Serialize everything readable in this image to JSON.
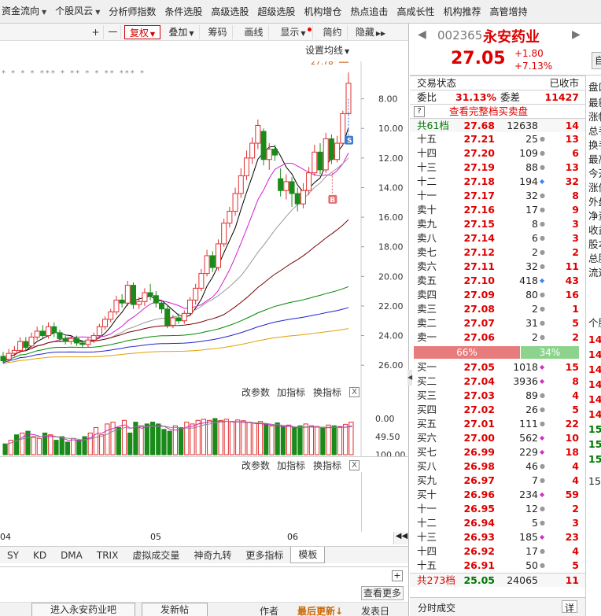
{
  "top_nav": [
    {
      "label": "资金流向",
      "dd": true
    },
    {
      "label": "个股风云",
      "dd": true
    },
    {
      "label": "分析师指数",
      "dd": false
    },
    {
      "label": "条件选股",
      "dd": false
    },
    {
      "label": "高级选股",
      "dd": false
    },
    {
      "label": "超级选股",
      "dd": false
    },
    {
      "label": "机构增仓",
      "dd": false
    },
    {
      "label": "热点追击",
      "dd": false
    },
    {
      "label": "高成长性",
      "dd": false
    },
    {
      "label": "机构推荐",
      "dd": false
    },
    {
      "label": "高管增持",
      "dd": false
    }
  ],
  "toolbar": {
    "plus": "+",
    "minus": "一",
    "fuquan": "复权",
    "overlay": "叠加",
    "chips": "筹码",
    "draw": "画线",
    "display": "显示",
    "simple": "简约",
    "hide": "隐藏"
  },
  "main_chart": {
    "set_ma": "设置均线",
    "high_label": "27.78",
    "y_ticks": [
      "26.00",
      "24.00",
      "22.00",
      "20.00",
      "18.00",
      "16.00",
      "14.00",
      "12.00",
      "10.00",
      "8.00"
    ],
    "marker_s": "S",
    "marker_b": "B",
    "stars": "* * * * *** * ** * * ** *** *"
  },
  "indicator_panel": {
    "change_params": "改参数",
    "add_indicator": "加指标",
    "swap_indicator": "换指标",
    "close": "X",
    "y_ticks": [
      "100.00",
      "49.50",
      "0.00"
    ]
  },
  "empty_panel": {
    "change_params": "改参数",
    "add_indicator": "加指标",
    "swap_indicator": "换指标",
    "close": "X"
  },
  "x_axis": [
    "04",
    "05",
    "06"
  ],
  "tabs": [
    "SY",
    "KD",
    "DMA",
    "TRIX",
    "虚拟成交量",
    "神奇九转",
    "更多指标",
    "模板"
  ],
  "lower": {
    "view_more": "查看更多",
    "enter_bar": "进入永安药业吧",
    "post": "发新帖",
    "author": "作者",
    "last_update": "最后更新",
    "post_date": "发表日"
  },
  "quote": {
    "code": "002365",
    "name": "永安药业",
    "price": "27.05",
    "change": "+1.80",
    "change_pct": "+7.13%",
    "side_btn": "自",
    "status_label": "交易状态",
    "status_value": "已收市",
    "weibi_label": "委比",
    "weibi_value": "31.13%",
    "weicha_label": "委差",
    "weicha_value": "11427",
    "full_book": "查看完整档买卖盘",
    "help": "?",
    "sell_total": {
      "label": "共61档",
      "price": "27.68",
      "vol": "12638",
      "cnt": "14"
    },
    "sells": [
      {
        "label": "十五",
        "price": "27.21",
        "vol": "25",
        "mark": "dot",
        "cnt": "13"
      },
      {
        "label": "十四",
        "price": "27.20",
        "vol": "109",
        "mark": "dot",
        "cnt": "6"
      },
      {
        "label": "十三",
        "price": "27.19",
        "vol": "88",
        "mark": "dot",
        "cnt": "13"
      },
      {
        "label": "十二",
        "price": "27.18",
        "vol": "194",
        "mark": "blue",
        "cnt": "32"
      },
      {
        "label": "十一",
        "price": "27.17",
        "vol": "32",
        "mark": "dot",
        "cnt": "8"
      },
      {
        "label": "卖十",
        "price": "27.16",
        "vol": "17",
        "mark": "dot",
        "cnt": "9"
      },
      {
        "label": "卖九",
        "price": "27.15",
        "vol": "8",
        "mark": "dot",
        "cnt": "3"
      },
      {
        "label": "卖八",
        "price": "27.14",
        "vol": "6",
        "mark": "dot",
        "cnt": "3"
      },
      {
        "label": "卖七",
        "price": "27.12",
        "vol": "2",
        "mark": "dot",
        "cnt": "2"
      },
      {
        "label": "卖六",
        "price": "27.11",
        "vol": "32",
        "mark": "dot",
        "cnt": "11"
      },
      {
        "label": "卖五",
        "price": "27.10",
        "vol": "418",
        "mark": "blue",
        "cnt": "43"
      },
      {
        "label": "卖四",
        "price": "27.09",
        "vol": "80",
        "mark": "dot",
        "cnt": "16"
      },
      {
        "label": "卖三",
        "price": "27.08",
        "vol": "2",
        "mark": "dot",
        "cnt": "1"
      },
      {
        "label": "卖二",
        "price": "27.07",
        "vol": "31",
        "mark": "dot",
        "cnt": "5"
      },
      {
        "label": "卖一",
        "price": "27.06",
        "vol": "2",
        "mark": "dot",
        "cnt": "2"
      }
    ],
    "ratio_buy": "66%",
    "ratio_sell": "34%",
    "buys": [
      {
        "label": "买一",
        "price": "27.05",
        "vol": "1018",
        "mark": "mag",
        "cnt": "15"
      },
      {
        "label": "买二",
        "price": "27.04",
        "vol": "3936",
        "mark": "mag",
        "cnt": "8"
      },
      {
        "label": "买三",
        "price": "27.03",
        "vol": "89",
        "mark": "dot",
        "cnt": "4"
      },
      {
        "label": "买四",
        "price": "27.02",
        "vol": "26",
        "mark": "dot",
        "cnt": "5"
      },
      {
        "label": "买五",
        "price": "27.01",
        "vol": "111",
        "mark": "dot",
        "cnt": "22"
      },
      {
        "label": "买六",
        "price": "27.00",
        "vol": "562",
        "mark": "mag",
        "cnt": "10"
      },
      {
        "label": "买七",
        "price": "26.99",
        "vol": "229",
        "mark": "mag",
        "cnt": "18"
      },
      {
        "label": "买八",
        "price": "26.98",
        "vol": "46",
        "mark": "dot",
        "cnt": "4"
      },
      {
        "label": "买九",
        "price": "26.97",
        "vol": "7",
        "mark": "dot",
        "cnt": "4"
      },
      {
        "label": "买十",
        "price": "26.96",
        "vol": "234",
        "mark": "mag",
        "cnt": "59"
      },
      {
        "label": "十一",
        "price": "26.95",
        "vol": "12",
        "mark": "dot",
        "cnt": "2"
      },
      {
        "label": "十二",
        "price": "26.94",
        "vol": "5",
        "mark": "dot",
        "cnt": "3"
      },
      {
        "label": "十三",
        "price": "26.93",
        "vol": "185",
        "mark": "mag",
        "cnt": "23"
      },
      {
        "label": "十四",
        "price": "26.92",
        "vol": "17",
        "mark": "dot",
        "cnt": "4"
      },
      {
        "label": "十五",
        "price": "26.91",
        "vol": "50",
        "mark": "dot",
        "cnt": "5"
      }
    ],
    "buy_total": {
      "label": "共273档",
      "price": "25.05",
      "vol": "24065",
      "cnt": "11"
    },
    "time_trade": "分时成交",
    "detail": "详"
  },
  "side_panel": {
    "head": "盘口",
    "labels": [
      "最新",
      "涨幅",
      "总手",
      "换手",
      "最高",
      "今开",
      "涨停",
      "外盘",
      "净资",
      "收益",
      "股本",
      "总股",
      "流通"
    ],
    "mid_head": "个股",
    "values": [
      "14",
      "14",
      "14",
      "14",
      "14",
      "14",
      "15",
      "15",
      "15"
    ],
    "last": "15"
  },
  "chart_data": [
    {
      "type": "candlestick",
      "x": [
        "04",
        "05",
        "06"
      ],
      "ylim": [
        7,
        28
      ],
      "y_ticks": [
        8,
        10,
        12,
        14,
        16,
        18,
        20,
        22,
        24,
        26
      ],
      "candles": [
        {
          "o": 8.6,
          "c": 8.3,
          "h": 8.9,
          "l": 8.1
        },
        {
          "o": 8.4,
          "c": 8.8,
          "h": 9.1,
          "l": 8.2
        },
        {
          "o": 8.8,
          "c": 9.0,
          "h": 9.3,
          "l": 8.6
        },
        {
          "o": 9.0,
          "c": 9.6,
          "h": 9.9,
          "l": 8.8
        },
        {
          "o": 9.6,
          "c": 9.2,
          "h": 9.9,
          "l": 9.0
        },
        {
          "o": 9.3,
          "c": 9.9,
          "h": 10.2,
          "l": 9.1
        },
        {
          "o": 9.9,
          "c": 10.3,
          "h": 10.6,
          "l": 9.7
        },
        {
          "o": 10.3,
          "c": 10.0,
          "h": 10.7,
          "l": 9.8
        },
        {
          "o": 10.0,
          "c": 10.6,
          "h": 10.9,
          "l": 9.8
        },
        {
          "o": 10.6,
          "c": 10.2,
          "h": 10.9,
          "l": 9.9
        },
        {
          "o": 10.2,
          "c": 9.8,
          "h": 10.4,
          "l": 9.6
        },
        {
          "o": 9.8,
          "c": 9.6,
          "h": 10.0,
          "l": 9.4
        },
        {
          "o": 9.6,
          "c": 9.8,
          "h": 10.0,
          "l": 9.4
        },
        {
          "o": 9.8,
          "c": 9.5,
          "h": 10.0,
          "l": 9.3
        },
        {
          "o": 9.5,
          "c": 9.4,
          "h": 9.7,
          "l": 9.2
        },
        {
          "o": 9.4,
          "c": 9.7,
          "h": 9.9,
          "l": 9.2
        },
        {
          "o": 9.7,
          "c": 10.0,
          "h": 10.2,
          "l": 9.5
        },
        {
          "o": 10.0,
          "c": 10.6,
          "h": 10.8,
          "l": 9.8
        },
        {
          "o": 10.6,
          "c": 11.1,
          "h": 11.3,
          "l": 10.4
        },
        {
          "o": 11.1,
          "c": 11.6,
          "h": 11.8,
          "l": 10.9
        },
        {
          "o": 11.6,
          "c": 12.4,
          "h": 12.7,
          "l": 11.4
        },
        {
          "o": 12.4,
          "c": 12.2,
          "h": 12.8,
          "l": 11.9
        },
        {
          "o": 12.2,
          "c": 13.4,
          "h": 13.7,
          "l": 12.0
        },
        {
          "o": 13.4,
          "c": 12.1,
          "h": 13.6,
          "l": 11.8
        },
        {
          "o": 12.1,
          "c": 12.3,
          "h": 12.6,
          "l": 11.8
        },
        {
          "o": 12.3,
          "c": 12.9,
          "h": 13.2,
          "l": 12.0
        },
        {
          "o": 12.9,
          "c": 12.7,
          "h": 13.5,
          "l": 12.4
        },
        {
          "o": 12.7,
          "c": 12.2,
          "h": 13.0,
          "l": 11.9
        },
        {
          "o": 12.2,
          "c": 11.8,
          "h": 12.4,
          "l": 11.5
        },
        {
          "o": 11.8,
          "c": 10.7,
          "h": 12.0,
          "l": 10.5
        },
        {
          "o": 10.7,
          "c": 11.2,
          "h": 11.4,
          "l": 10.5
        },
        {
          "o": 11.2,
          "c": 11.0,
          "h": 11.5,
          "l": 10.8
        },
        {
          "o": 11.0,
          "c": 11.5,
          "h": 11.7,
          "l": 10.8
        },
        {
          "o": 11.5,
          "c": 12.4,
          "h": 12.6,
          "l": 11.3
        },
        {
          "o": 12.4,
          "c": 13.2,
          "h": 13.5,
          "l": 12.1
        },
        {
          "o": 13.2,
          "c": 14.2,
          "h": 14.5,
          "l": 13.0
        },
        {
          "o": 14.2,
          "c": 15.4,
          "h": 15.8,
          "l": 14.0
        },
        {
          "o": 15.4,
          "c": 14.6,
          "h": 15.7,
          "l": 14.3
        },
        {
          "o": 14.6,
          "c": 16.2,
          "h": 16.5,
          "l": 14.4
        },
        {
          "o": 16.2,
          "c": 17.6,
          "h": 17.9,
          "l": 16.0
        },
        {
          "o": 17.6,
          "c": 18.4,
          "h": 18.7,
          "l": 17.3
        },
        {
          "o": 18.4,
          "c": 19.6,
          "h": 20.0,
          "l": 18.1
        },
        {
          "o": 19.6,
          "c": 20.8,
          "h": 21.3,
          "l": 19.3
        },
        {
          "o": 20.8,
          "c": 22.0,
          "h": 22.5,
          "l": 20.5
        },
        {
          "o": 22.0,
          "c": 23.0,
          "h": 23.4,
          "l": 21.6
        },
        {
          "o": 23.0,
          "c": 24.2,
          "h": 24.6,
          "l": 22.6
        },
        {
          "o": 23.8,
          "c": 21.9,
          "h": 24.0,
          "l": 21.5
        },
        {
          "o": 21.9,
          "c": 22.6,
          "h": 23.0,
          "l": 21.2
        },
        {
          "o": 22.6,
          "c": 22.2,
          "h": 22.9,
          "l": 21.8
        },
        {
          "o": 20.6,
          "c": 19.8,
          "h": 21.3,
          "l": 19.4
        },
        {
          "o": 19.8,
          "c": 20.4,
          "h": 20.9,
          "l": 19.2
        },
        {
          "o": 20.4,
          "c": 19.6,
          "h": 20.7,
          "l": 18.7
        },
        {
          "o": 19.6,
          "c": 18.9,
          "h": 20.0,
          "l": 18.4
        },
        {
          "o": 18.9,
          "c": 19.8,
          "h": 20.3,
          "l": 18.6
        },
        {
          "o": 19.8,
          "c": 21.0,
          "h": 21.4,
          "l": 19.5
        },
        {
          "o": 21.0,
          "c": 22.4,
          "h": 22.9,
          "l": 20.8
        },
        {
          "o": 22.4,
          "c": 21.2,
          "h": 23.0,
          "l": 20.9
        },
        {
          "o": 21.2,
          "c": 23.3,
          "h": 23.7,
          "l": 21.0
        },
        {
          "o": 23.3,
          "c": 21.9,
          "h": 23.6,
          "l": 21.6
        },
        {
          "o": 21.9,
          "c": 23.0,
          "h": 23.5,
          "l": 21.7
        },
        {
          "o": 23.0,
          "c": 25.0,
          "h": 25.2,
          "l": 22.9
        },
        {
          "o": 25.0,
          "c": 27.05,
          "h": 27.78,
          "l": 24.9
        }
      ]
    },
    {
      "type": "bar",
      "ylim": [
        0,
        100
      ],
      "y_ticks": [
        0,
        49.5,
        100
      ],
      "values": [
        30,
        40,
        55,
        60,
        65,
        50,
        45,
        60,
        55,
        40,
        50,
        35,
        45,
        40,
        50,
        60,
        75,
        55,
        85,
        90,
        75,
        95,
        60,
        90,
        80,
        85,
        90,
        85,
        70,
        65,
        80,
        75,
        90,
        85,
        95,
        98,
        95,
        100,
        95,
        98,
        92,
        96,
        94,
        90,
        88,
        92,
        85,
        80,
        88,
        78,
        82,
        75,
        80,
        85,
        80,
        78,
        76,
        82,
        80,
        78,
        84,
        90
      ],
      "up": [
        0,
        1,
        0,
        1,
        0,
        1,
        1,
        0,
        1,
        0,
        0,
        0,
        1,
        0,
        0,
        1,
        1,
        1,
        1,
        1,
        0,
        1,
        0,
        0,
        1,
        0,
        0,
        0,
        0,
        0,
        1,
        0,
        1,
        1,
        1,
        1,
        1,
        0,
        1,
        1,
        1,
        1,
        1,
        1,
        1,
        1,
        0,
        1,
        0,
        0,
        1,
        0,
        0,
        1,
        1,
        1,
        0,
        1,
        0,
        1,
        1,
        1
      ]
    }
  ]
}
